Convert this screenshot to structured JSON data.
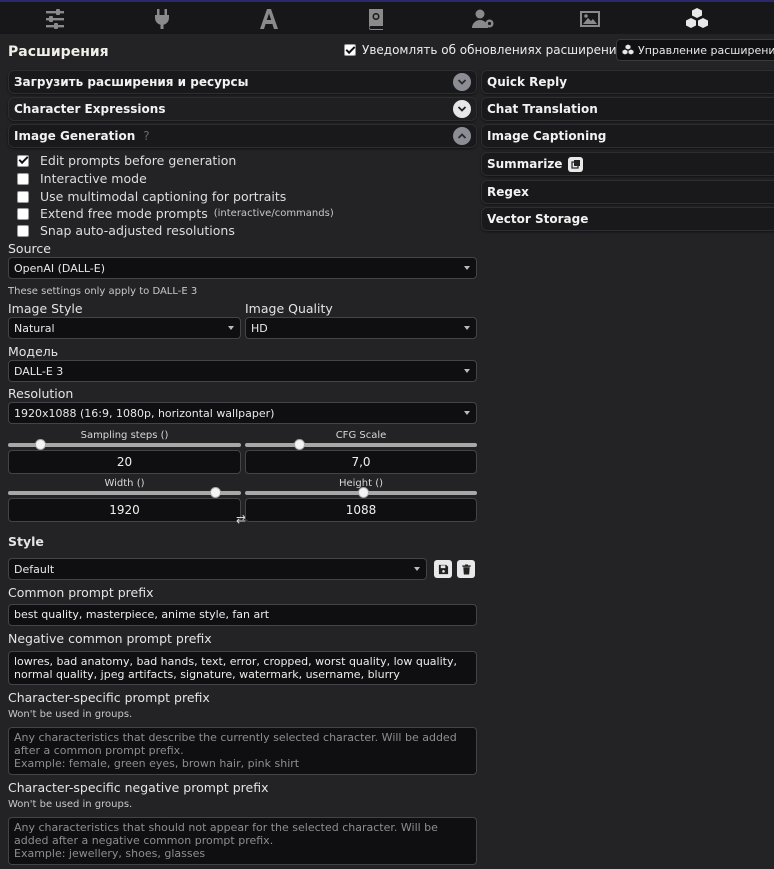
{
  "nav": {
    "icons": [
      "sliders-icon",
      "plug-icon",
      "font-icon",
      "book-icon",
      "user-gear-icon",
      "image-icon",
      "cubes-icon"
    ]
  },
  "panel": {
    "title": "Расширения",
    "notify_label": "Уведомлять об обновлениях расширений",
    "notify_checked": true,
    "manage_label": "Управление расширениями"
  },
  "left_accordions": [
    {
      "label": "Загрузить расширения и ресурсы"
    },
    {
      "label": "Character Expressions"
    },
    {
      "label": "Image Generation",
      "hint": "?"
    }
  ],
  "right_accordions": [
    {
      "label": "Quick Reply"
    },
    {
      "label": "Chat Translation"
    },
    {
      "label": "Image Captioning"
    },
    {
      "label": "Summarize"
    },
    {
      "label": "Regex"
    },
    {
      "label": "Vector Storage"
    }
  ],
  "image_gen": {
    "options": [
      {
        "label": "Edit prompts before generation",
        "checked": true
      },
      {
        "label": "Interactive mode",
        "checked": false
      },
      {
        "label": "Use multimodal captioning for portraits",
        "checked": false
      },
      {
        "label": "Extend free mode prompts",
        "small": "(interactive/commands)",
        "checked": false
      },
      {
        "label": "Snap auto-adjusted resolutions",
        "checked": false
      }
    ],
    "source_label": "Source",
    "source_value": "OpenAI (DALL-E)",
    "dalle_note": "These settings only apply to DALL-E 3",
    "style_label": "Image Style",
    "style_value": "Natural",
    "quality_label": "Image Quality",
    "quality_value": "HD",
    "model_label": "Модель",
    "model_value": "DALL-E 3",
    "resolution_label": "Resolution",
    "resolution_value": "1920x1088 (16:9, 1080p, horizontal wallpaper)",
    "steps": {
      "label": "Sampling steps ()",
      "value": "20",
      "fraction": 0.12
    },
    "cfg": {
      "label": "CFG Scale",
      "value": "7,0",
      "fraction": 0.22
    },
    "width": {
      "label": "Width ()",
      "value": "1920",
      "fraction": 0.91
    },
    "height": {
      "label": "Height ()",
      "value": "1088",
      "fraction": 0.51
    },
    "style_section_label": "Style",
    "style_preset": "Default",
    "common_prefix_label": "Common prompt prefix",
    "common_prefix_value": "best quality, masterpiece, anime style, fan art",
    "negative_prefix_label": "Negative common prompt prefix",
    "negative_prefix_value": "lowres, bad anatomy, bad hands, text, error, cropped, worst quality, low quality, normal quality, jpeg artifacts, signature, watermark, username, blurry",
    "char_prefix_label": "Character-specific prompt prefix",
    "char_prefix_note": "Won't be used in groups.",
    "char_prefix_placeholder": "Any characteristics that describe the currently selected character. Will be added after a common prompt prefix.\nExample: female, green eyes, brown hair, pink shirt",
    "char_neg_label": "Character-specific negative prompt prefix",
    "char_neg_note": "Won't be used in groups.",
    "char_neg_placeholder": "Any characteristics that should not appear for the selected character. Will be added after a negative common prompt prefix.\nExample: jewellery, shoes, glasses"
  }
}
